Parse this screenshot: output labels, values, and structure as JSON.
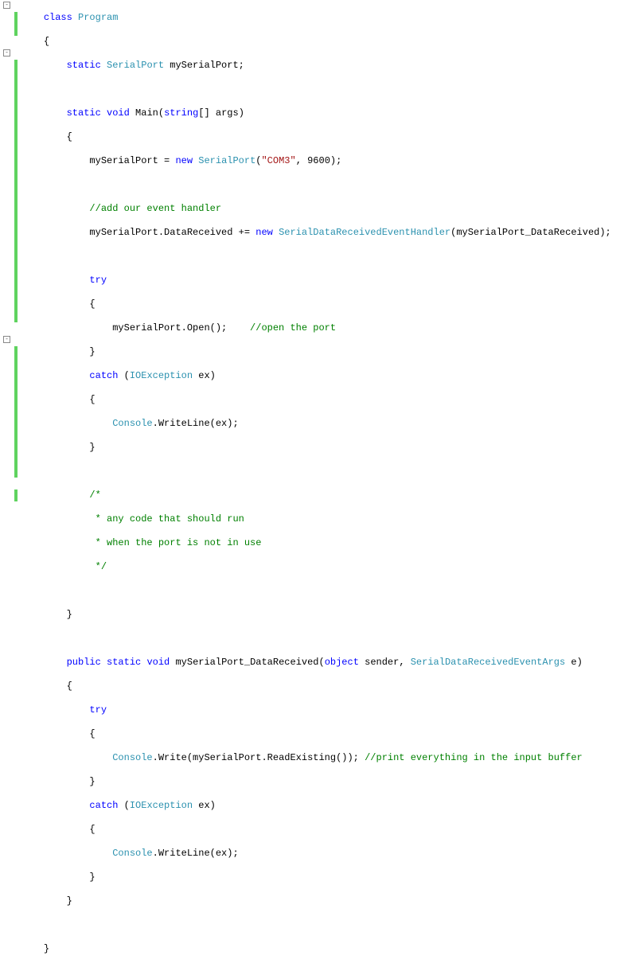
{
  "code": {
    "l1_class": "class",
    "l1_program": "Program",
    "l2_brace": "{",
    "l3_static": "static",
    "l3_type": "SerialPort",
    "l3_rest": " mySerialPort;",
    "l5_static": "static",
    "l5_void": "void",
    "l5_main": " Main(",
    "l5_string": "string",
    "l5_rest": "[] args)",
    "l6_brace": "{",
    "l7_a": "mySerialPort = ",
    "l7_new": "new",
    "l7_b": " ",
    "l7_type": "SerialPort",
    "l7_c": "(",
    "l7_str": "\"COM3\"",
    "l7_d": ", 9600);",
    "l9_cm": "//add our event handler",
    "l10_a": "mySerialPort.DataReceived += ",
    "l10_new": "new",
    "l10_b": " ",
    "l10_type": "SerialDataReceivedEventHandler",
    "l10_c": "(mySerialPort_DataReceived);",
    "l12_try": "try",
    "l13_brace": "{",
    "l14_a": "mySerialPort.Open();    ",
    "l14_cm": "//open the port",
    "l15_brace": "}",
    "l16_catch": "catch",
    "l16_a": " (",
    "l16_type": "IOException",
    "l16_b": " ex)",
    "l17_brace": "{",
    "l18_type": "Console",
    "l18_a": ".WriteLine(ex);",
    "l19_brace": "}",
    "l21_cm1": "/*",
    "l22_cm2": " * any code that should run",
    "l23_cm3": " * when the port is not in use",
    "l24_cm4": " */",
    "l26_brace": "}",
    "l28_public": "public",
    "l28_static": "static",
    "l28_void": "void",
    "l28_a": " mySerialPort_DataReceived(",
    "l28_object": "object",
    "l28_b": " sender, ",
    "l28_type": "SerialDataReceivedEventArgs",
    "l28_c": " e)",
    "l29_brace": "{",
    "l30_try": "try",
    "l31_brace": "{",
    "l32_type": "Console",
    "l32_a": ".Write(mySerialPort.ReadExisting()); ",
    "l32_cm": "//print everything in the input buffer",
    "l33_brace": "}",
    "l34_catch": "catch",
    "l34_a": " (",
    "l34_type": "IOException",
    "l34_b": " ex)",
    "l35_brace": "{",
    "l36_type": "Console",
    "l36_a": ".WriteLine(ex);",
    "l37_brace": "}",
    "l38_brace": "}",
    "l40_brace": "}"
  },
  "fold": {
    "minus": "-"
  }
}
